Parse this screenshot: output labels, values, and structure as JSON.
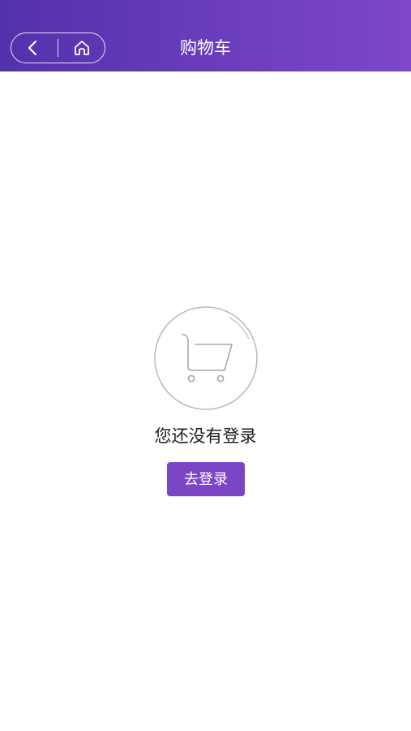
{
  "colors": {
    "header_gradient_start": "#5331ac",
    "header_gradient_end": "#7f47cb",
    "accent": "#7b45c6"
  },
  "header": {
    "title": "购物车",
    "back_icon": "back-arrow-icon",
    "home_icon": "home-icon"
  },
  "empty_state": {
    "illustration_icon": "shopping-cart-icon",
    "message": "您还没有登录",
    "login_button_label": "去登录"
  }
}
